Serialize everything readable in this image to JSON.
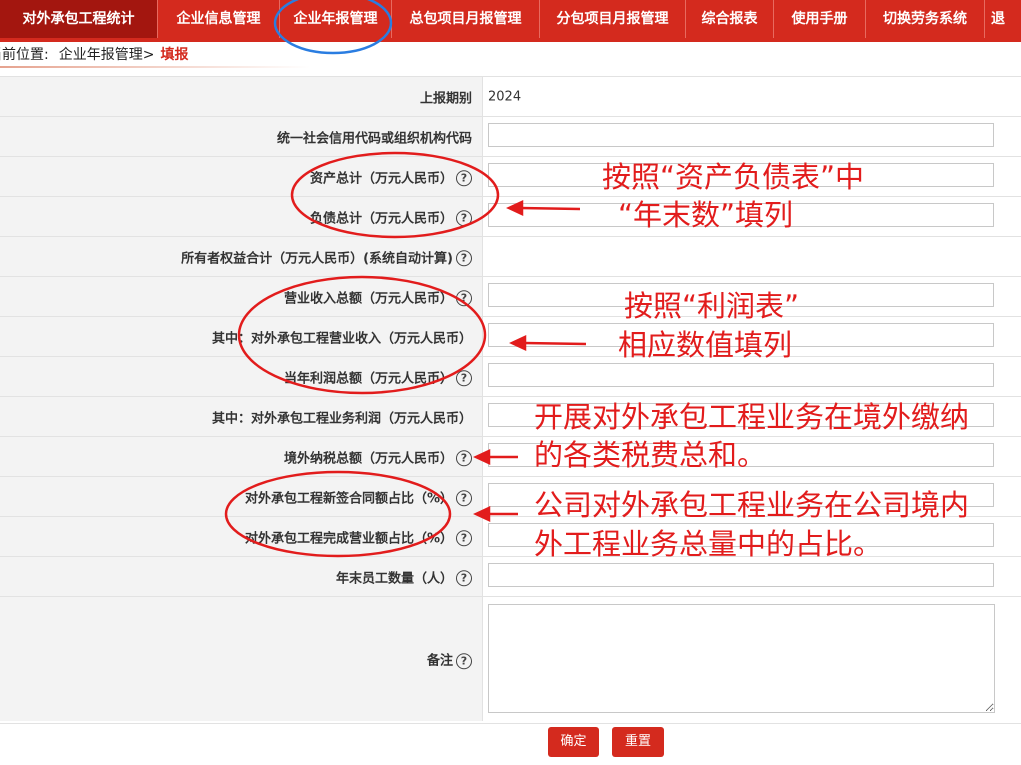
{
  "nav": {
    "items": [
      {
        "label": "对外承包工程统计"
      },
      {
        "label": "企业信息管理"
      },
      {
        "label": "企业年报管理"
      },
      {
        "label": "总包项目月报管理"
      },
      {
        "label": "分包项目月报管理"
      },
      {
        "label": "综合报表"
      },
      {
        "label": "使用手册"
      },
      {
        "label": "切换劳务系统"
      },
      {
        "label": "退"
      }
    ]
  },
  "breadcrumb": {
    "prefix": "当前位置:",
    "parent": "企业年报管理>",
    "current": "填报"
  },
  "form": {
    "rows": [
      {
        "label": "上报期别",
        "value": "2024"
      },
      {
        "label": "统一社会信用代码或组织机构代码"
      },
      {
        "label": "资产总计（万元人民币）"
      },
      {
        "label": "负债总计（万元人民币）"
      },
      {
        "label": "所有者权益合计（万元人民币）(系统自动计算)"
      },
      {
        "label": "营业收入总额（万元人民币）"
      },
      {
        "label": "其中：对外承包工程营业收入（万元人民币）"
      },
      {
        "label": "当年利润总额（万元人民币）"
      },
      {
        "label": "其中：对外承包工程业务利润（万元人民币）"
      },
      {
        "label": "境外纳税总额（万元人民币）"
      },
      {
        "label": "对外承包工程新签合同额占比（%）"
      },
      {
        "label": "对外承包工程完成营业额占比（%）"
      },
      {
        "label": "年末员工数量（人）"
      },
      {
        "label": "备注"
      }
    ],
    "help_glyph": "?"
  },
  "buttons": {
    "confirm": "确定",
    "reset": "重置"
  },
  "annotations": {
    "note1_line1": "按照“资产负债表”中",
    "note1_line2": "“年末数”填列",
    "note2_line1": "按照“利润表”",
    "note2_line2": "相应数值填列",
    "note3_line1": "开展对外承包工程业务在境外缴纳",
    "note3_line2": "的各类税费总和。",
    "note4_line1": "公司对外承包工程业务在公司境内",
    "note4_line2": "外工程业务总量中的占比。"
  },
  "colors": {
    "nav_bg": "#d42a1e",
    "nav_active": "#a3160f",
    "annotation": "#e21c1c",
    "highlight_circle": "#2a7de1"
  }
}
